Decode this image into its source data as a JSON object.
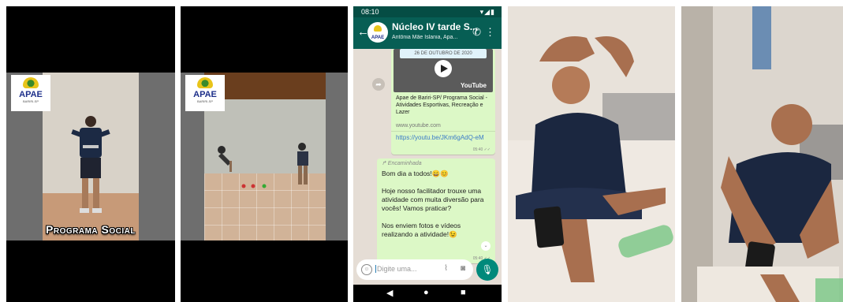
{
  "panel1": {
    "logo": {
      "name": "APAE",
      "tiny": "BARIRI-SP"
    },
    "caption": "Programa Social"
  },
  "panel2": {
    "logo": {
      "name": "APAE",
      "tiny": "BARIRI-SP"
    }
  },
  "whatsapp": {
    "status": {
      "time": "08:10",
      "icons": "▾◢▮"
    },
    "header": {
      "title": "Núcleo IV tarde S...",
      "subtitle": "Antônia Mãe Islania, Apa...",
      "avatar": "APAE"
    },
    "message1": {
      "date": "26 DE OUTUBRO DE 2020",
      "youtube": "YouTube",
      "description": "Apae de Bariri-SP/ Programa Social - Atividades Esportivas, Recreação e Lazer",
      "site": "www.youtube.com",
      "link": "https://youtu.be/JKm6gAdQ-eM",
      "time": "05:40 ✓✓"
    },
    "message2": {
      "forwarded": "↱ Encaminhada",
      "text": "Bom dia a todos!😄😊\n\nHoje nosso facilitador trouxe uma atividade com muita diversão para vocês! Vamos praticar?\n\nNos enviem fotos e vídeos realizando a atividade!😉",
      "time": "05:40 ✓✓"
    },
    "input": {
      "placeholder": "Digite uma..."
    },
    "nav": {
      "back": "◀",
      "home": "●",
      "recent": "■"
    }
  },
  "colors": {
    "wa_header": "#075e54",
    "wa_status": "#054d44",
    "wa_bubble": "#dcf8c6",
    "wa_bg": "#e5ddd5",
    "wa_mic": "#00897b",
    "apae_blue": "#1d2f8a",
    "apae_yellow": "#e8c41a"
  }
}
